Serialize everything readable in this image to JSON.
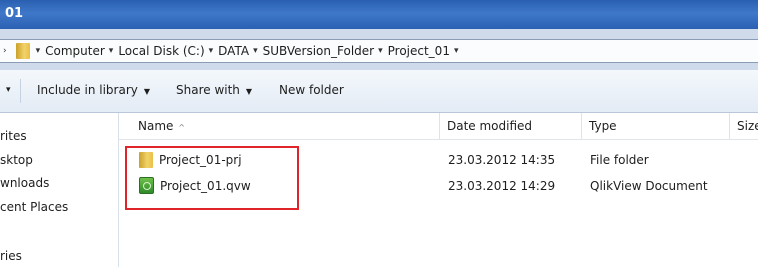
{
  "window": {
    "title": "01"
  },
  "address_bar": {
    "crumbs": [
      "Computer",
      "Local Disk (C:)",
      "DATA",
      "SUBVersion_Folder",
      "Project_01"
    ]
  },
  "toolbar": {
    "organize_arrow": "▾",
    "include_in_library": "Include in library",
    "share_with": "Share with",
    "new_folder": "New folder"
  },
  "nav": {
    "items": [
      "rites",
      "sktop",
      "wnloads",
      "cent Places",
      "ries"
    ]
  },
  "columns": {
    "name": "Name",
    "date_modified": "Date modified",
    "type": "Type",
    "size": "Size"
  },
  "files": [
    {
      "name": "Project_01-prj",
      "date": "23.03.2012 14:35",
      "type": "File folder",
      "icon": "folder-icon"
    },
    {
      "name": "Project_01.qvw",
      "date": "23.03.2012 14:29",
      "type": "QlikView Document",
      "icon": "qlikview-document-icon"
    }
  ],
  "colors": {
    "highlight": "#e0252a",
    "titlebar": "#2f6bbf"
  }
}
